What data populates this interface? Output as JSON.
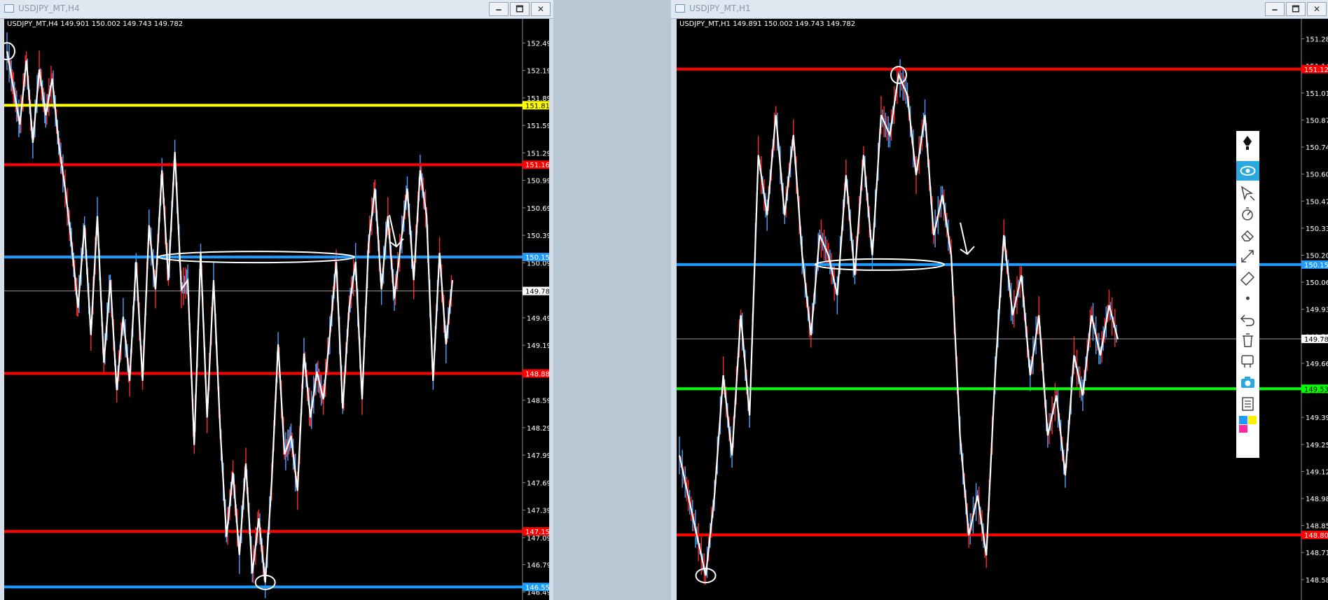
{
  "windows": [
    {
      "title": "USDJPY_MT,H4",
      "header": "USDJPY_MT,H4  149.901 150.002 149.743 149.782",
      "buttons": {
        "minimize": "🗕",
        "maximize": "🗖",
        "close": "✕"
      }
    },
    {
      "title": "USDJPY_MT,H1",
      "header": "USDJPY_MT,H1  149.891 150.002 149.743 149.782",
      "buttons": {
        "minimize": "🗕",
        "maximize": "🗖",
        "close": "✕"
      }
    }
  ],
  "toolbar": {
    "icons": [
      "pen-icon",
      "eye-icon",
      "cursor-icon",
      "stopwatch-icon",
      "eraser-icon",
      "resize-icon",
      "ruler-icon",
      "dot-icon",
      "undo-icon",
      "trash-icon",
      "projector-icon",
      "camera-icon",
      "clipboard-icon",
      "palette-icon"
    ],
    "accent": "#2aa8e0"
  },
  "chart_data": [
    {
      "type": "candlestick",
      "symbol": "USDJPY_MT",
      "timeframe": "H4",
      "ylim": [
        146.5,
        152.6
      ],
      "y_ticks": [
        "152.490",
        "152.190",
        "151.890",
        "151.590",
        "151.290",
        "150.990",
        "150.690",
        "150.390",
        "150.090",
        "149.490",
        "149.190",
        "148.890",
        "148.590",
        "148.290",
        "147.990",
        "147.690",
        "147.390",
        "147.090",
        "146.795",
        "146.495"
      ],
      "horizontal_lines": [
        {
          "price": 151.81,
          "label": "151.810",
          "color": "#ffff00"
        },
        {
          "price": 151.161,
          "label": "151.161",
          "color": "#ff0000"
        },
        {
          "price": 150.153,
          "label": "150.153",
          "color": "#1e9bff"
        },
        {
          "price": 148.882,
          "label": "148.882",
          "color": "#ff0000"
        },
        {
          "price": 147.157,
          "label": "147.157",
          "color": "#ff0000"
        },
        {
          "price": 146.551,
          "label": "146.551",
          "color": "#1e9bff"
        }
      ],
      "current_price": {
        "price": 149.782,
        "label": "149.782"
      },
      "price_path": [
        152.4,
        152.0,
        151.6,
        152.3,
        151.4,
        152.2,
        151.7,
        152.1,
        151.4,
        150.9,
        150.3,
        149.6,
        150.5,
        149.3,
        150.6,
        149.0,
        149.9,
        148.7,
        149.5,
        148.8,
        150.1,
        148.8,
        150.5,
        149.8,
        151.1,
        149.9,
        151.3,
        149.8,
        149.9,
        148.1,
        150.2,
        148.4,
        149.9,
        148.3,
        147.1,
        147.8,
        146.9,
        147.9,
        146.7,
        147.3,
        146.6,
        147.7,
        149.2,
        148.0,
        148.2,
        147.6,
        149.1,
        148.4,
        148.9,
        148.6,
        149.3,
        150.1,
        148.5,
        149.6,
        150.1,
        148.6,
        150.3,
        150.9,
        149.8,
        150.6,
        149.7,
        150.3,
        150.9,
        149.9,
        151.1,
        150.6,
        148.8,
        150.2,
        149.2,
        149.9
      ]
    },
    {
      "type": "candlestick",
      "symbol": "USDJPY_MT",
      "timeframe": "H1",
      "ylim": [
        148.52,
        151.31
      ],
      "y_ticks": [
        "151.280",
        "151.145",
        "151.010",
        "150.875",
        "150.740",
        "150.605",
        "150.470",
        "150.335",
        "150.200",
        "150.065",
        "149.930",
        "149.795",
        "149.660",
        "149.525",
        "149.390",
        "149.255",
        "149.120",
        "148.985",
        "148.850",
        "148.715",
        "148.580"
      ],
      "horizontal_lines": [
        {
          "price": 151.129,
          "label": "151.129",
          "color": "#ff0000"
        },
        {
          "price": 150.153,
          "label": "150.153",
          "color": "#1e9bff"
        },
        {
          "price": 149.533,
          "label": "149.533",
          "color": "#00ff00"
        },
        {
          "price": 148.803,
          "label": "148.803",
          "color": "#ff0000"
        }
      ],
      "current_price": {
        "price": 149.782,
        "label": "149.782"
      },
      "price_path": [
        149.2,
        149.0,
        148.8,
        148.6,
        149.0,
        149.6,
        149.2,
        149.9,
        149.4,
        150.7,
        150.4,
        150.9,
        150.4,
        150.8,
        150.2,
        149.8,
        150.3,
        150.2,
        150.0,
        150.6,
        150.1,
        150.7,
        150.2,
        150.9,
        150.8,
        151.1,
        151.0,
        150.6,
        150.9,
        150.3,
        150.5,
        150.2,
        149.3,
        148.8,
        149.0,
        148.7,
        149.6,
        150.3,
        149.9,
        150.1,
        149.6,
        149.9,
        149.3,
        149.5,
        149.1,
        149.7,
        149.5,
        149.9,
        149.7,
        149.95,
        149.78
      ]
    }
  ]
}
